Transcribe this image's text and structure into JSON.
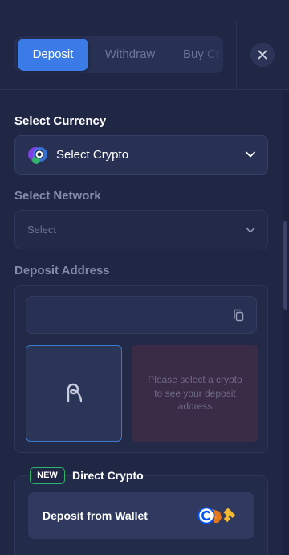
{
  "tabs": [
    {
      "label": "Deposit",
      "active": true
    },
    {
      "label": "Withdraw",
      "active": false
    },
    {
      "label": "Buy Cr",
      "active": false
    }
  ],
  "icons": {
    "close": "close-icon",
    "chevron": "chevron-down-icon",
    "copy": "copy-icon",
    "qr_placeholder": "qr-logo-icon",
    "crypto": "crypto-logo-icon",
    "wallets": [
      "coinbase-icon",
      "metamask-icon",
      "binance-icon"
    ]
  },
  "currency": {
    "label": "Select Currency",
    "value": "Select Crypto"
  },
  "network": {
    "label": "Select Network",
    "placeholder": "Select"
  },
  "address": {
    "label": "Deposit Address",
    "value": "",
    "message": "Please select a crypto to see your deposit address"
  },
  "direct": {
    "badge": "NEW",
    "title": "Direct Crypto",
    "wallet_button": "Deposit from Wallet"
  },
  "colors": {
    "background": "#1f2745",
    "accent": "#3b7be8",
    "badge_border": "#2fb56a"
  }
}
